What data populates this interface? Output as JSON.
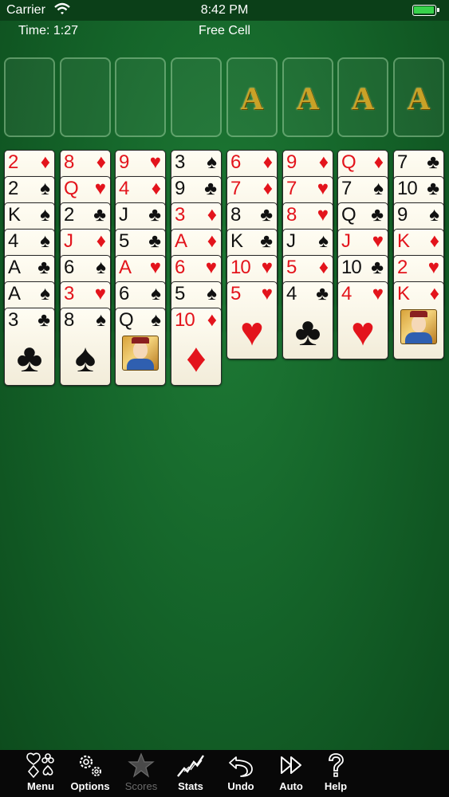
{
  "status_bar": {
    "carrier": "Carrier",
    "time": "8:42 PM"
  },
  "header": {
    "timer": "Time: 1:27",
    "title": "Free Cell"
  },
  "foundations": [
    {
      "label": "A"
    },
    {
      "label": "A"
    },
    {
      "label": "A"
    },
    {
      "label": "A"
    }
  ],
  "suit_symbols": {
    "spades": "♠",
    "hearts": "♥",
    "diamonds": "♦",
    "clubs": "♣"
  },
  "colors": {
    "red": "#e3141c",
    "black": "#111111",
    "felt": "#15652a",
    "gold": "#c9a227"
  },
  "columns": [
    [
      {
        "rank": "2",
        "suit": "diamonds"
      },
      {
        "rank": "2",
        "suit": "spades"
      },
      {
        "rank": "K",
        "suit": "spades"
      },
      {
        "rank": "4",
        "suit": "spades"
      },
      {
        "rank": "A",
        "suit": "clubs"
      },
      {
        "rank": "A",
        "suit": "spades"
      },
      {
        "rank": "3",
        "suit": "clubs"
      }
    ],
    [
      {
        "rank": "8",
        "suit": "diamonds"
      },
      {
        "rank": "Q",
        "suit": "hearts"
      },
      {
        "rank": "2",
        "suit": "clubs"
      },
      {
        "rank": "J",
        "suit": "diamonds"
      },
      {
        "rank": "6",
        "suit": "spades"
      },
      {
        "rank": "3",
        "suit": "hearts"
      },
      {
        "rank": "8",
        "suit": "spades"
      }
    ],
    [
      {
        "rank": "9",
        "suit": "hearts"
      },
      {
        "rank": "4",
        "suit": "diamonds"
      },
      {
        "rank": "J",
        "suit": "clubs"
      },
      {
        "rank": "5",
        "suit": "clubs"
      },
      {
        "rank": "A",
        "suit": "hearts"
      },
      {
        "rank": "6",
        "suit": "spades"
      },
      {
        "rank": "Q",
        "suit": "spades"
      }
    ],
    [
      {
        "rank": "3",
        "suit": "spades"
      },
      {
        "rank": "9",
        "suit": "clubs"
      },
      {
        "rank": "3",
        "suit": "diamonds"
      },
      {
        "rank": "A",
        "suit": "diamonds"
      },
      {
        "rank": "6",
        "suit": "hearts"
      },
      {
        "rank": "5",
        "suit": "spades"
      },
      {
        "rank": "10",
        "suit": "diamonds"
      }
    ],
    [
      {
        "rank": "6",
        "suit": "diamonds"
      },
      {
        "rank": "7",
        "suit": "diamonds"
      },
      {
        "rank": "8",
        "suit": "clubs"
      },
      {
        "rank": "K",
        "suit": "clubs"
      },
      {
        "rank": "10",
        "suit": "hearts"
      },
      {
        "rank": "5",
        "suit": "hearts"
      }
    ],
    [
      {
        "rank": "9",
        "suit": "diamonds"
      },
      {
        "rank": "7",
        "suit": "hearts"
      },
      {
        "rank": "8",
        "suit": "hearts"
      },
      {
        "rank": "J",
        "suit": "spades"
      },
      {
        "rank": "5",
        "suit": "diamonds"
      },
      {
        "rank": "4",
        "suit": "clubs"
      }
    ],
    [
      {
        "rank": "Q",
        "suit": "diamonds"
      },
      {
        "rank": "7",
        "suit": "spades"
      },
      {
        "rank": "Q",
        "suit": "clubs"
      },
      {
        "rank": "J",
        "suit": "hearts"
      },
      {
        "rank": "10",
        "suit": "clubs"
      },
      {
        "rank": "4",
        "suit": "hearts"
      }
    ],
    [
      {
        "rank": "7",
        "suit": "clubs"
      },
      {
        "rank": "10",
        "suit": "clubs"
      },
      {
        "rank": "9",
        "suit": "spades"
      },
      {
        "rank": "K",
        "suit": "diamonds"
      },
      {
        "rank": "2",
        "suit": "hearts"
      },
      {
        "rank": "K",
        "suit": "diamonds"
      }
    ]
  ],
  "toolbar": [
    {
      "key": "menu",
      "label": "Menu",
      "icon": "suits-icon",
      "enabled": true
    },
    {
      "key": "options",
      "label": "Options",
      "icon": "gears-icon",
      "enabled": true
    },
    {
      "key": "scores",
      "label": "Scores",
      "icon": "star-icon",
      "enabled": false
    },
    {
      "key": "stats",
      "label": "Stats",
      "icon": "chart-icon",
      "enabled": true
    },
    {
      "key": "undo",
      "label": "Undo",
      "icon": "undo-icon",
      "enabled": true
    },
    {
      "key": "auto",
      "label": "Auto",
      "icon": "fast-forward-icon",
      "enabled": true
    },
    {
      "key": "help",
      "label": "Help",
      "icon": "question-icon",
      "enabled": true
    }
  ]
}
